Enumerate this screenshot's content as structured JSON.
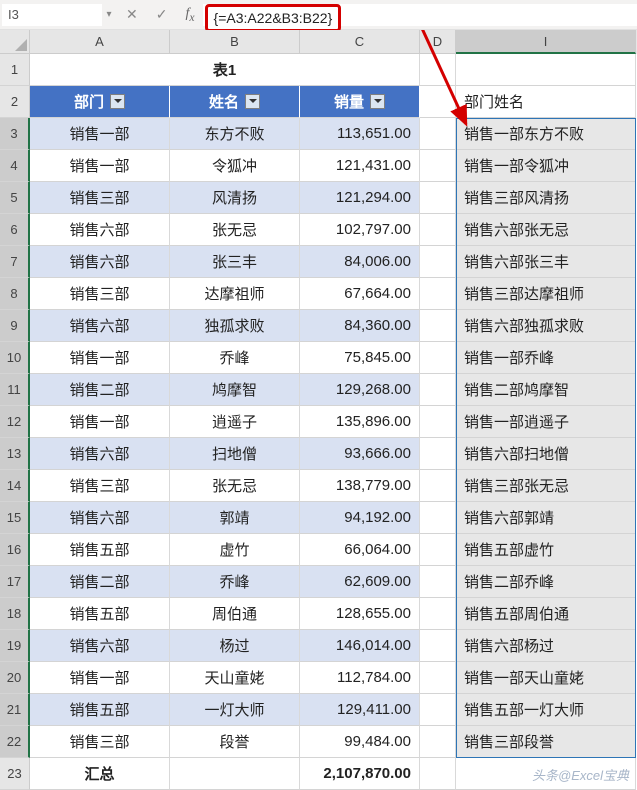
{
  "namebox": "I3",
  "formula": "{=A3:A22&B3:B22}",
  "col_headers": [
    "A",
    "B",
    "C",
    "D",
    "I"
  ],
  "row_headers": [
    "1",
    "2",
    "3",
    "4",
    "5",
    "6",
    "7",
    "8",
    "9",
    "10",
    "11",
    "12",
    "13",
    "14",
    "15",
    "16",
    "17",
    "18",
    "19",
    "20",
    "21",
    "22",
    "23"
  ],
  "title": "表1",
  "table_headers": {
    "dept": "部门",
    "name": "姓名",
    "sales": "销量"
  },
  "i_header": "部门姓名",
  "rows": [
    {
      "dept": "销售一部",
      "name": "东方不败",
      "sales": "113,651.00",
      "concat": "销售一部东方不败"
    },
    {
      "dept": "销售一部",
      "name": "令狐冲",
      "sales": "121,431.00",
      "concat": "销售一部令狐冲"
    },
    {
      "dept": "销售三部",
      "name": "风清扬",
      "sales": "121,294.00",
      "concat": "销售三部风清扬"
    },
    {
      "dept": "销售六部",
      "name": "张无忌",
      "sales": "102,797.00",
      "concat": "销售六部张无忌"
    },
    {
      "dept": "销售六部",
      "name": "张三丰",
      "sales": "84,006.00",
      "concat": "销售六部张三丰"
    },
    {
      "dept": "销售三部",
      "name": "达摩祖师",
      "sales": "67,664.00",
      "concat": "销售三部达摩祖师"
    },
    {
      "dept": "销售六部",
      "name": "独孤求败",
      "sales": "84,360.00",
      "concat": "销售六部独孤求败"
    },
    {
      "dept": "销售一部",
      "name": "乔峰",
      "sales": "75,845.00",
      "concat": "销售一部乔峰"
    },
    {
      "dept": "销售二部",
      "name": "鸠摩智",
      "sales": "129,268.00",
      "concat": "销售二部鸠摩智"
    },
    {
      "dept": "销售一部",
      "name": "逍遥子",
      "sales": "135,896.00",
      "concat": "销售一部逍遥子"
    },
    {
      "dept": "销售六部",
      "name": "扫地僧",
      "sales": "93,666.00",
      "concat": "销售六部扫地僧"
    },
    {
      "dept": "销售三部",
      "name": "张无忌",
      "sales": "138,779.00",
      "concat": "销售三部张无忌"
    },
    {
      "dept": "销售六部",
      "name": "郭靖",
      "sales": "94,192.00",
      "concat": "销售六部郭靖"
    },
    {
      "dept": "销售五部",
      "name": "虚竹",
      "sales": "66,064.00",
      "concat": "销售五部虚竹"
    },
    {
      "dept": "销售二部",
      "name": "乔峰",
      "sales": "62,609.00",
      "concat": "销售二部乔峰"
    },
    {
      "dept": "销售五部",
      "name": "周伯通",
      "sales": "128,655.00",
      "concat": "销售五部周伯通"
    },
    {
      "dept": "销售六部",
      "name": "杨过",
      "sales": "146,014.00",
      "concat": "销售六部杨过"
    },
    {
      "dept": "销售一部",
      "name": "天山童姥",
      "sales": "112,784.00",
      "concat": "销售一部天山童姥"
    },
    {
      "dept": "销售五部",
      "name": "一灯大师",
      "sales": "129,411.00",
      "concat": "销售五部一灯大师"
    },
    {
      "dept": "销售三部",
      "name": "段誉",
      "sales": "99,484.00",
      "concat": "销售三部段誉"
    }
  ],
  "total": {
    "label": "汇总",
    "value": "2,107,870.00"
  },
  "watermark": "头条@Excel宝典"
}
